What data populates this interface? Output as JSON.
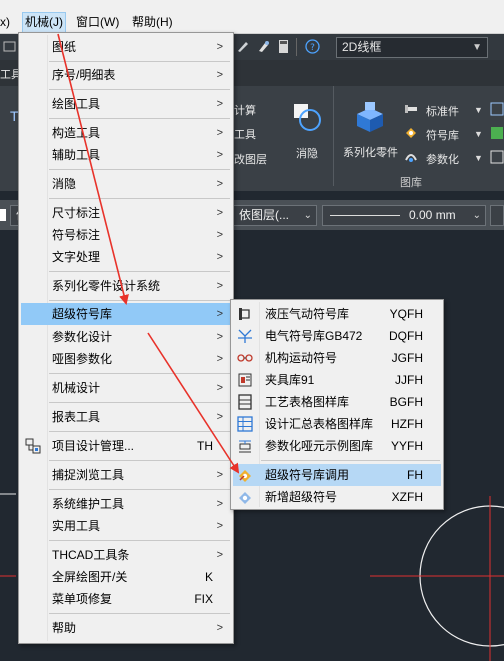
{
  "menubar": {
    "partial_left": "x)",
    "items": [
      {
        "label": "机械(J)",
        "active": true
      },
      {
        "label": "窗口(W)"
      },
      {
        "label": "帮助(H)"
      }
    ]
  },
  "toolbar": {
    "visual_style": "2D线框",
    "left_stub": "工具",
    "help_glyph": "?"
  },
  "ribbon": {
    "labels": {
      "calc": "计算",
      "tools": "工具",
      "change_layer": "改图层",
      "erase": "消隐",
      "series_parts": "系列化零件",
      "standard_parts": "标准件",
      "symbol_lib": "符号库",
      "parametric": "参数化",
      "panel_title": "图库",
      "left_stub": "T"
    }
  },
  "properties": {
    "layer_stub": "依",
    "by_layer": "依图层(...",
    "lineweight": "0.00 mm"
  },
  "main_menu": {
    "items": [
      {
        "label": "图纸",
        "submenu": true
      },
      {
        "label": "序号/明细表",
        "submenu": true
      },
      {
        "label": "绘图工具",
        "submenu": true
      },
      {
        "label": "构造工具",
        "submenu": true
      },
      {
        "label": "辅助工具",
        "submenu": true
      },
      {
        "label": "消隐",
        "submenu": true
      },
      {
        "label": "尺寸标注",
        "submenu": true
      },
      {
        "label": "符号标注",
        "submenu": true
      },
      {
        "label": "文字处理",
        "submenu": true
      },
      {
        "label": "系列化零件设计系统",
        "submenu": true
      },
      {
        "label": "超级符号库",
        "submenu": true,
        "highlighted": true
      },
      {
        "label": "参数化设计",
        "submenu": true
      },
      {
        "label": "哑图参数化",
        "submenu": true
      },
      {
        "label": "机械设计",
        "submenu": true
      },
      {
        "label": "报表工具",
        "submenu": true
      },
      {
        "label": "项目设计管理...",
        "shortcut": "TH",
        "icon": "project-manager-icon"
      },
      {
        "label": "捕捉浏览工具",
        "submenu": true
      },
      {
        "label": "系统维护工具",
        "submenu": true
      },
      {
        "label": "实用工具",
        "submenu": true
      },
      {
        "label": "THCAD工具条",
        "submenu": true
      },
      {
        "label": "全屏绘图开/关",
        "shortcut": "K"
      },
      {
        "label": "菜单项修复",
        "shortcut": "FIX"
      },
      {
        "label": "帮助",
        "submenu": true
      }
    ]
  },
  "submenu": {
    "items": [
      {
        "label": "液压气动符号库",
        "shortcut": "YQFH",
        "icon": "hydraulic-symbol-icon"
      },
      {
        "label": "电气符号库GB472",
        "shortcut": "DQFH",
        "icon": "electrical-symbol-icon"
      },
      {
        "label": "机构运动符号",
        "shortcut": "JGFH",
        "icon": "mechanism-motion-icon"
      },
      {
        "label": "夹具库91",
        "shortcut": "JJFH",
        "icon": "fixture-library-icon"
      },
      {
        "label": "工艺表格图样库",
        "shortcut": "BGFH",
        "icon": "process-table-icon"
      },
      {
        "label": "设计汇总表格图样库",
        "shortcut": "HZFH",
        "icon": "summary-table-icon"
      },
      {
        "label": "参数化哑元示例图库",
        "shortcut": "YYFH",
        "icon": "parametric-dummy-icon"
      },
      {
        "label": "超级符号库调用",
        "shortcut": "FH",
        "icon": "symbol-call-icon",
        "highlighted": true
      },
      {
        "label": "新增超级符号",
        "shortcut": "XZFH",
        "icon": "add-symbol-icon"
      }
    ]
  },
  "colors": {
    "menu_bg": "#f0f0f0",
    "highlight": "#91c9f7",
    "canvas_bg": "#212830",
    "annotation_arrow": "#e8322a",
    "crosshair": "#e03030"
  }
}
